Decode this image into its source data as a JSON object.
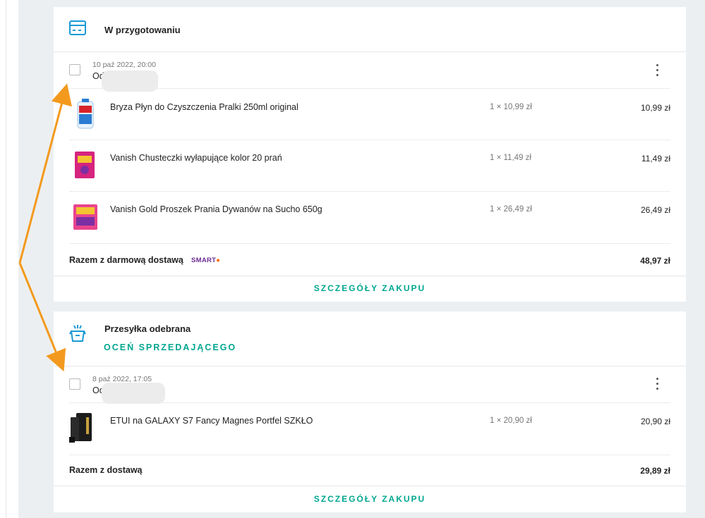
{
  "orders": [
    {
      "status": "W przygotowaniu",
      "date": "10 paź 2022, 20:00",
      "from_prefix": "Od",
      "items": [
        {
          "name": "Bryza Płyn do Czyszczenia Pralki 250ml original",
          "qty": "1 × 10,99 zł",
          "price": "10,99 zł",
          "image": "bryza-bottle"
        },
        {
          "name": "Vanish Chusteczki wyłapujące kolor 20 prań",
          "qty": "1 × 11,49 zł",
          "price": "11,49 zł",
          "image": "vanish-box-pink"
        },
        {
          "name": "Vanish Gold Proszek Prania Dywanów na Sucho 650g",
          "qty": "1 × 26,49 zł",
          "price": "26,49 zł",
          "image": "vanish-gold-box"
        }
      ],
      "total_label": "Razem z darmową dostawą",
      "smart_badge": "SMART",
      "total_value": "48,97 zł",
      "details_label": "SZCZEGÓŁY ZAKUPU"
    },
    {
      "status": "Przesyłka odebrana",
      "rate_seller_label": "OCEŃ SPRZEDAJĄCEGO",
      "date": "8 paź 2022, 17:05",
      "from_prefix": "Od",
      "items": [
        {
          "name": "ETUI na GALAXY S7 Fancy Magnes Portfel SZKŁO",
          "qty": "1 × 20,90 zł",
          "price": "20,90 zł",
          "image": "phone-case"
        }
      ],
      "total_label": "Razem z dostawą",
      "total_value": "29,89 zł",
      "details_label": "SZCZEGÓŁY ZAKUPU"
    }
  ],
  "colors": {
    "accent": "#00a790",
    "arrow": "#f39a1e",
    "smart": "#6a2c91",
    "icon_blue": "#1b9ad6"
  },
  "icons": [
    "package-preparing-icon",
    "package-received-icon",
    "more-vertical-icon"
  ]
}
